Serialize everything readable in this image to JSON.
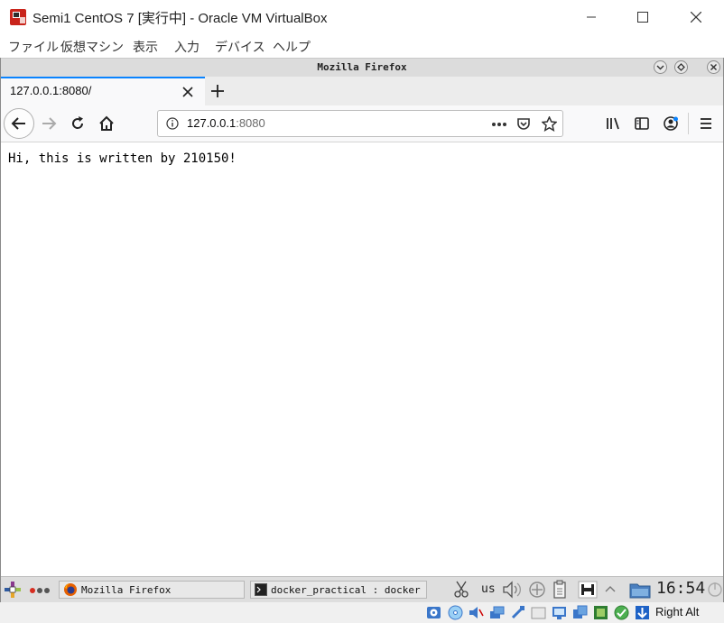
{
  "vbox": {
    "title": "Semi1 CentOS 7 [実行中] - Oracle VM VirtualBox",
    "menu": [
      "ファイル",
      "仮想マシン",
      "表示",
      "入力",
      "デバイス",
      "ヘルプ"
    ],
    "host_key": "Right Alt"
  },
  "guest_window": {
    "title": "Mozilla Firefox"
  },
  "firefox": {
    "tab_title": "127.0.0.1:8080/",
    "url_host": "127.0.0.1",
    "url_port": ":8080",
    "page_text": "Hi, this is written by 210150!"
  },
  "taskbar": {
    "tasks": [
      "Mozilla Firefox",
      "docker_practical : docker - l"
    ],
    "keyboard_layout": "us",
    "clock": "16:54"
  },
  "colors": {
    "accent": "#0a84ff",
    "titlebar": "#dcdcdc",
    "taskbar": "#dedede"
  }
}
